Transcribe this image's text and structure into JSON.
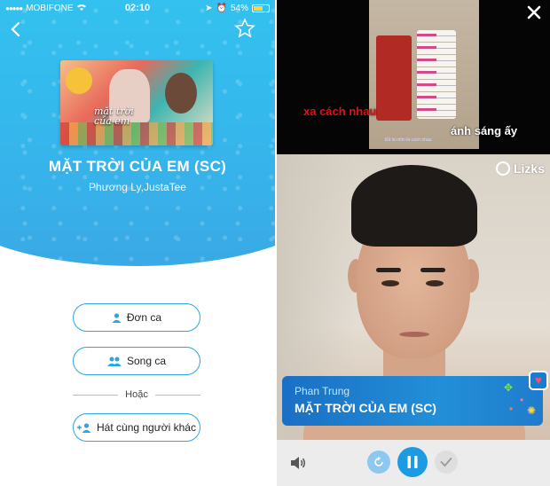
{
  "status_bar": {
    "carrier": "MOBIFONE",
    "time": "02:10",
    "battery": "54%"
  },
  "song": {
    "title": "MẶT TRỜI CỦA EM (SC)",
    "artists": "Phương Ly,JustaTee",
    "cover_text": "mặt trời\ncủa em"
  },
  "options": {
    "solo_label": "Đơn ca",
    "duet_label": "Song ca",
    "or_label": "Hoặc",
    "sing_with_others_label": "Hát cùng người khác"
  },
  "video": {
    "lyric_left": "xa cách nhau",
    "lyric_right": "ánh sáng ấy",
    "lyric_small": "Đủ là nhìn là cách nhau"
  },
  "watermark": "Lizks",
  "now_singing": {
    "singer": "Phan Trung",
    "title": "MẶT TRỜI CỦA EM (SC)"
  },
  "colors": {
    "accent": "#1c9be4",
    "hero": "#35b7ec",
    "lyric_active": "#e01313"
  },
  "icons": [
    "back-icon",
    "star-icon",
    "person-icon",
    "people-icon",
    "add-person-icon",
    "close-icon",
    "volume-icon",
    "replay-icon",
    "pause-icon",
    "check-icon",
    "heart-icon"
  ]
}
